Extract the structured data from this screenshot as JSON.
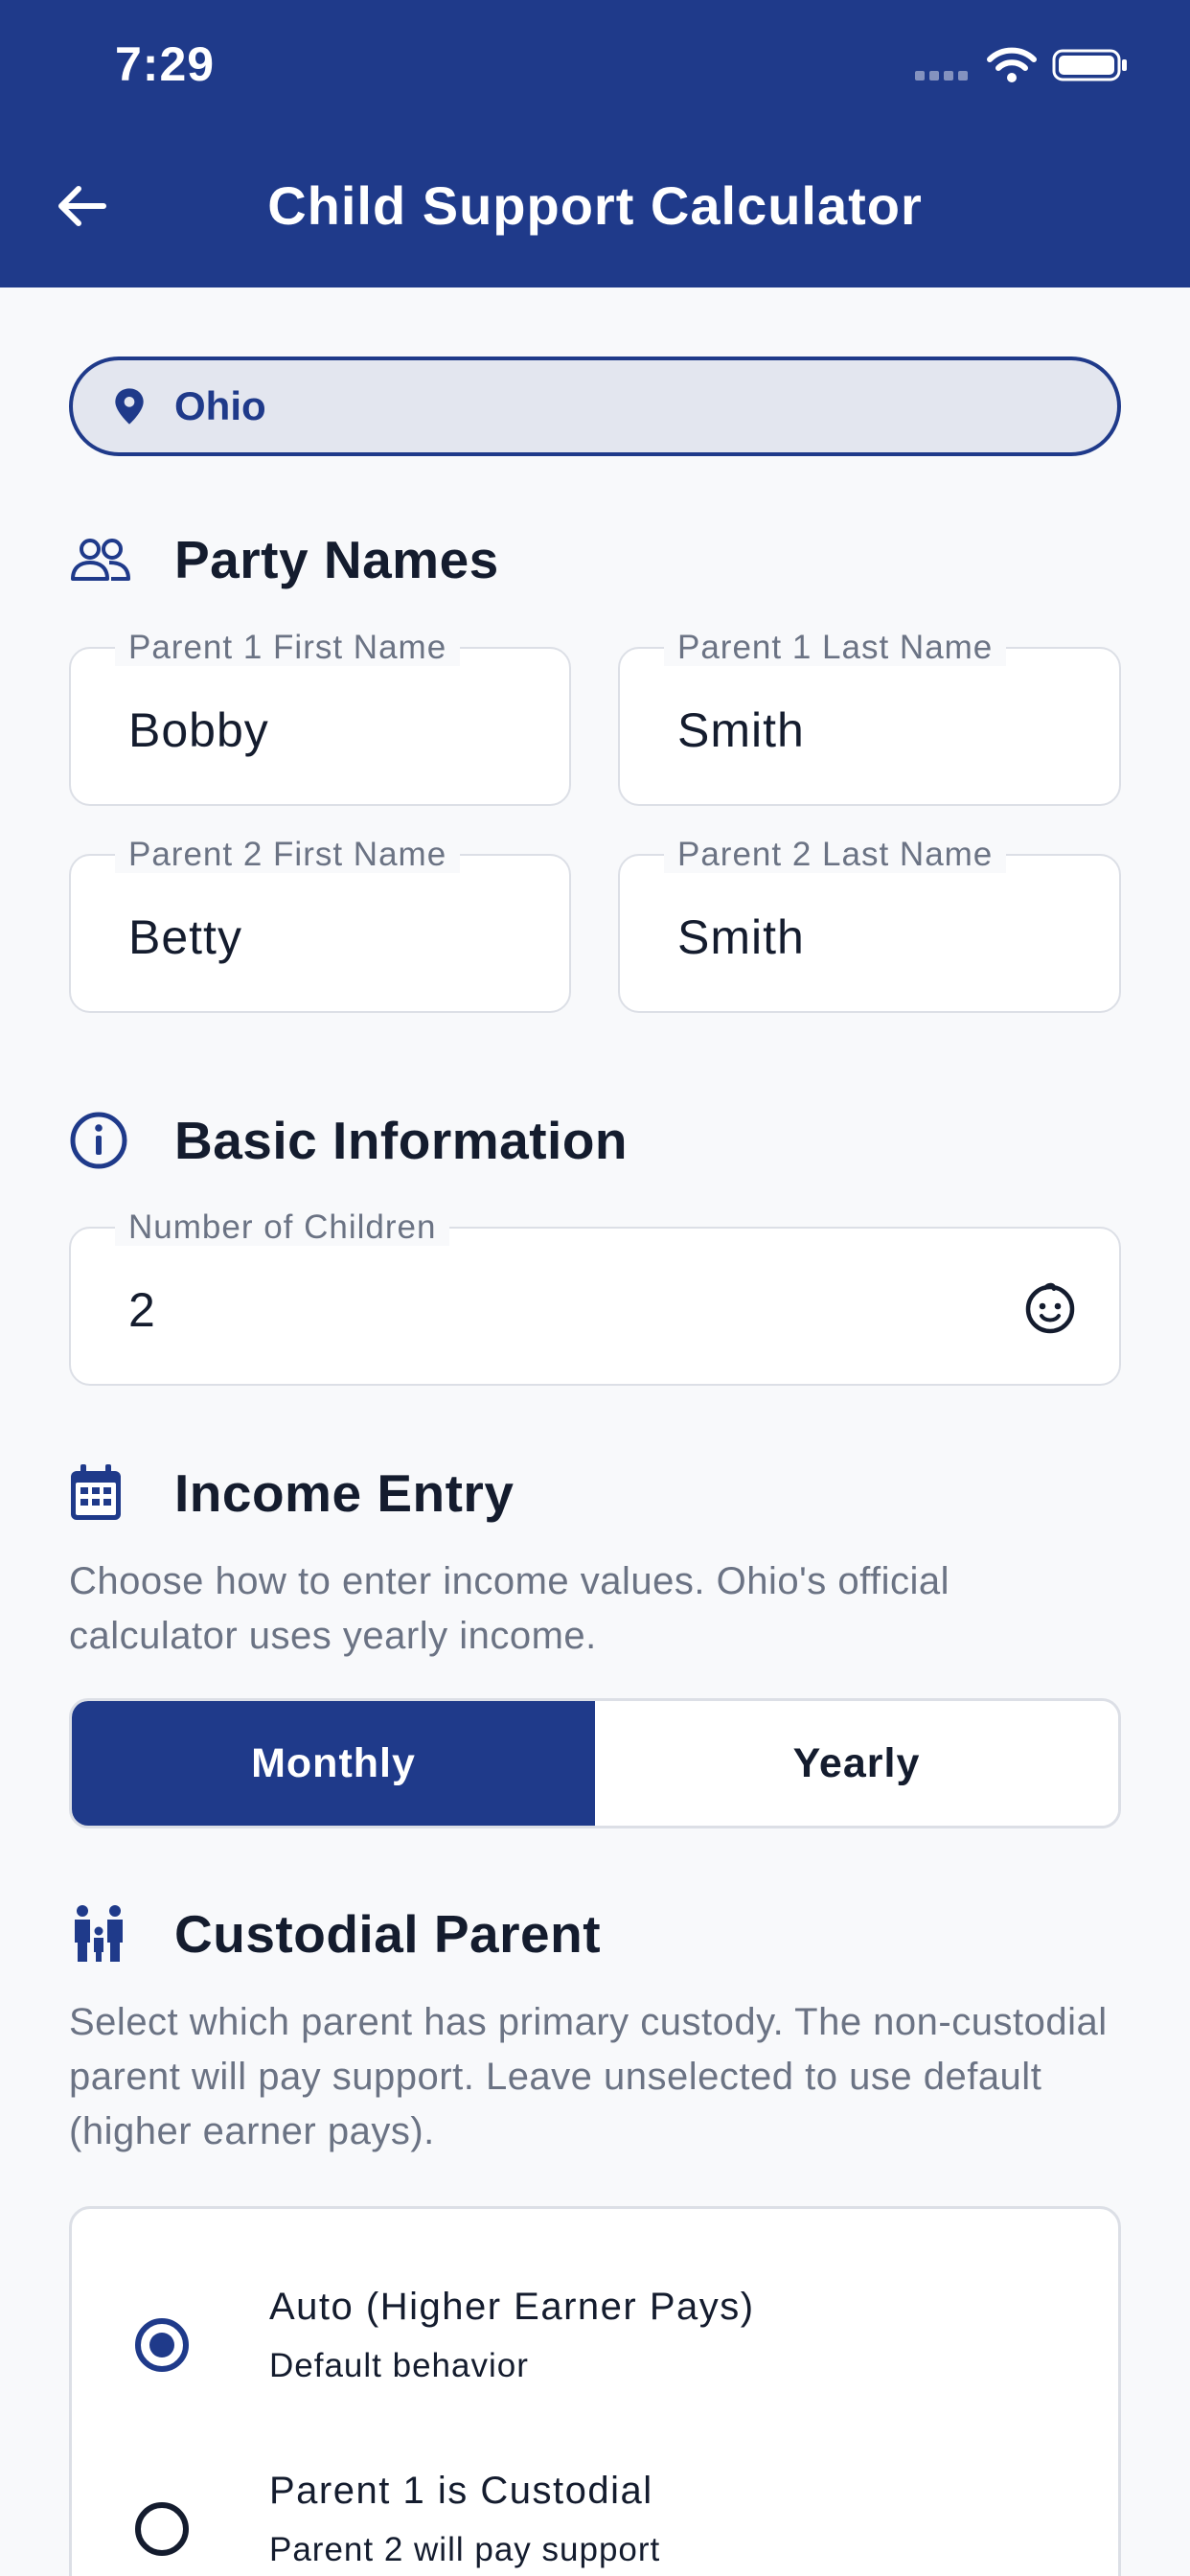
{
  "status_bar": {
    "time": "7:29"
  },
  "header": {
    "title": "Child Support Calculator"
  },
  "state": {
    "name": "Ohio"
  },
  "party_names": {
    "title": "Party Names",
    "fields": [
      {
        "label": "Parent 1 First Name",
        "value": "Bobby"
      },
      {
        "label": "Parent 1 Last Name",
        "value": "Smith"
      },
      {
        "label": "Parent 2 First Name",
        "value": "Betty"
      },
      {
        "label": "Parent 2 Last Name",
        "value": "Smith"
      }
    ]
  },
  "basic_info": {
    "title": "Basic Information",
    "children_label": "Number of Children",
    "children_value": "2"
  },
  "income_entry": {
    "title": "Income Entry",
    "description": "Choose how to enter income values. Ohio's official calculator uses yearly income.",
    "options": [
      "Monthly",
      "Yearly"
    ],
    "selected": "Monthly"
  },
  "custodial_parent": {
    "title": "Custodial Parent",
    "description": "Select which parent has primary custody. The non-custodial parent will pay support. Leave unselected to use default (higher earner pays).",
    "options": [
      {
        "title": "Auto (Higher Earner Pays)",
        "subtitle": "Default behavior",
        "selected": true
      },
      {
        "title": "Parent 1 is Custodial",
        "subtitle": "Parent 2 will pay support",
        "selected": false
      }
    ]
  },
  "colors": {
    "primary": "#1f3a8a",
    "background": "#f8f9fb",
    "muted_text": "#6b7384",
    "border": "#dcdfe6"
  },
  "icons": [
    "back-arrow-icon",
    "wifi-icon",
    "battery-icon",
    "location-pin-icon",
    "people-icon",
    "info-icon",
    "baby-face-icon",
    "calendar-icon",
    "family-icon"
  ]
}
